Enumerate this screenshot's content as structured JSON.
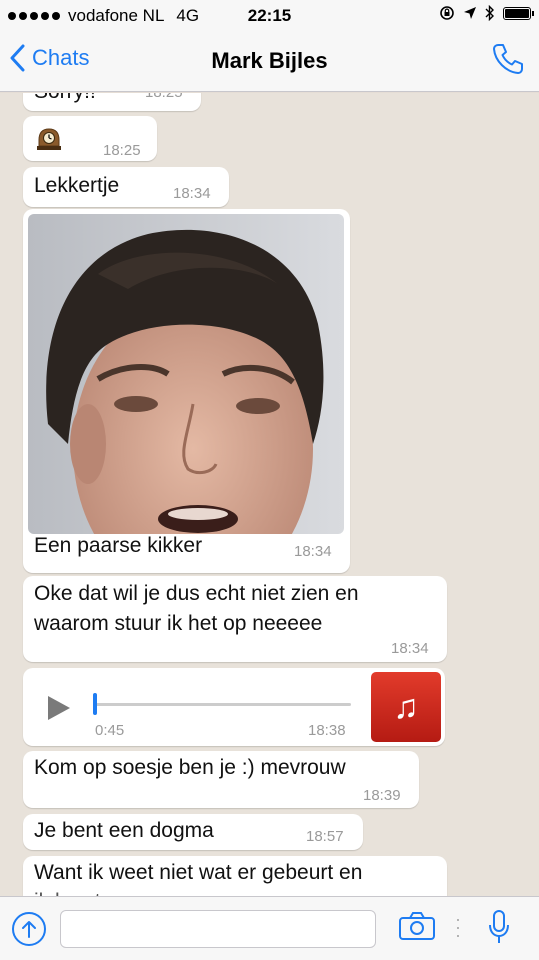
{
  "status_bar": {
    "carrier": "vodafone NL",
    "network": "4G",
    "time": "22:15"
  },
  "nav": {
    "back_label": "Chats",
    "contact_name": "Mark Bijles"
  },
  "messages": [
    {
      "type": "text",
      "text": "Sorry!!",
      "time": "18:25"
    },
    {
      "type": "emoji",
      "icon": "mantel-clock-icon",
      "time": "18:25"
    },
    {
      "type": "text",
      "text": "Lekkertje",
      "time": "18:34"
    },
    {
      "type": "image",
      "caption": "Een paarse kikker",
      "time": "18:34"
    },
    {
      "type": "text",
      "lines": [
        "Oke dat wil je dus echt niet zien en",
        "waarom stuur ik het op neeeee"
      ],
      "time": "18:34"
    },
    {
      "type": "audio",
      "duration": "0:45",
      "progress": 0.0,
      "time": "18:38"
    },
    {
      "type": "text",
      "text": "Kom op soesje ben je :) mevrouw",
      "time": "18:39"
    },
    {
      "type": "text",
      "text": "Je bent een dogma",
      "time": "18:57"
    },
    {
      "type": "text",
      "lines": [
        "Want ik weet niet wat er gebeurt en",
        "ik kan toen... "
      ],
      "time": ""
    }
  ],
  "colors": {
    "accent": "#1e7cf2",
    "chat_background": "#e8e2da",
    "bubble": "#ffffff",
    "timestamp": "#9a9a9a",
    "audio_art": "#c9271d"
  }
}
